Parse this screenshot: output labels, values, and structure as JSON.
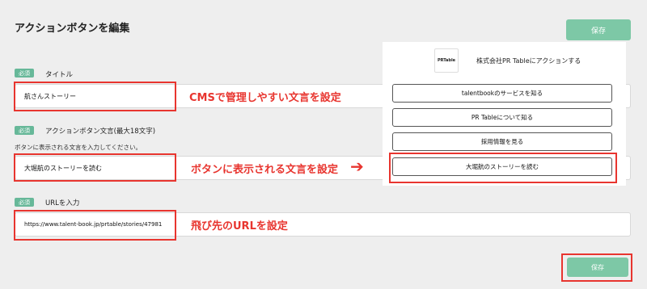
{
  "header": {
    "title": "アクションボタンを編集",
    "save_label": "保存"
  },
  "fields": {
    "title": {
      "required_label": "必須",
      "label": "タイトル",
      "value": "航さんストーリー"
    },
    "button_text": {
      "required_label": "必須",
      "label": "アクションボタン文言(最大18文字)",
      "help": "ボタンに表示される文言を入力してください。",
      "value": "大堀航のストーリーを読む"
    },
    "url": {
      "required_label": "必須",
      "label": "URLを入力",
      "value": "https://www.talent-book.jp/prtable/stories/47981"
    }
  },
  "annotations": {
    "cms": "CMSで管理しやすい文言を設定",
    "button": "ボタンに表示される文言を設定",
    "url": "飛び先のURLを設定"
  },
  "preview": {
    "logo_text": "PRTable",
    "company": "株式会社PR Tableにアクションする",
    "buttons": [
      "talentbookのサービスを知る",
      "PR Tableについて知る",
      "採用情報を見る",
      "大堀航のストーリーを読む"
    ]
  },
  "footer": {
    "save_label": "保存"
  },
  "colors": {
    "accent": "#7dc8a6",
    "annotation_red": "#e8352f"
  }
}
